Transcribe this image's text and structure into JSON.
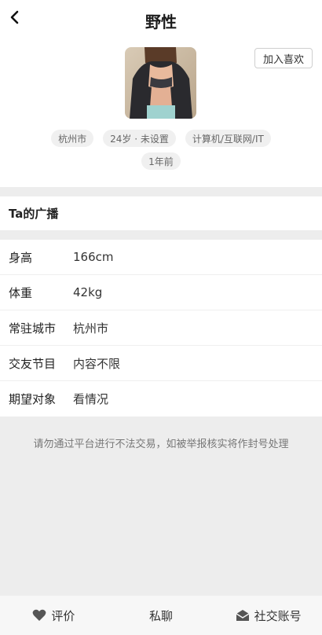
{
  "header": {
    "title": "野性"
  },
  "profile": {
    "like_button": "加入喜欢",
    "tags": [
      "杭州市",
      "24岁 · 未设置",
      "计算机/互联网/IT"
    ],
    "time_tag": "1年前"
  },
  "broadcast": {
    "title": "Ta的广播"
  },
  "info": {
    "rows": [
      {
        "label": "身高",
        "value": "166cm"
      },
      {
        "label": "体重",
        "value": "42kg"
      },
      {
        "label": "常驻城市",
        "value": "杭州市"
      },
      {
        "label": "交友节目",
        "value": "内容不限"
      },
      {
        "label": "期望对象",
        "value": "看情况"
      }
    ]
  },
  "notice": "请勿通过平台进行不法交易，如被举报核实将作封号处理",
  "bottom_bar": {
    "review": "评价",
    "chat": "私聊",
    "social": "社交账号"
  }
}
